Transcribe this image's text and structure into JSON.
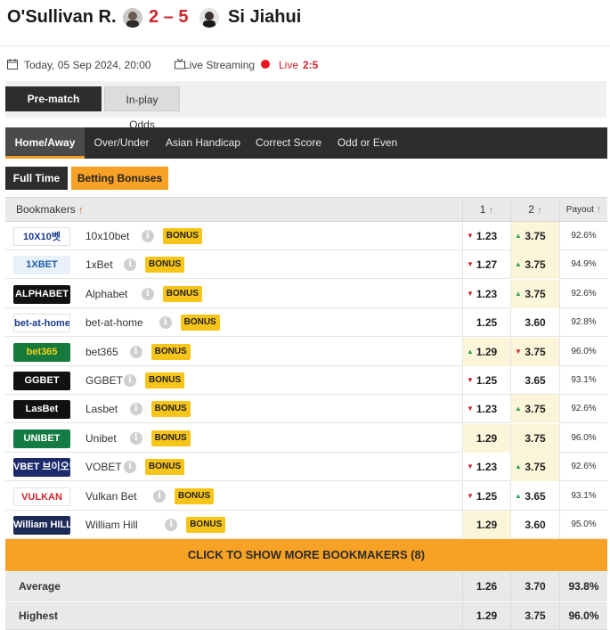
{
  "match": {
    "home_name": "O'Sullivan R.",
    "score": "2 – 5",
    "away_name": "Si Jiahui"
  },
  "info": {
    "date": "Today, 05 Sep 2024, 20:00",
    "streaming": "Live Streaming",
    "live_label": "Live",
    "live_score": "2:5"
  },
  "odds_type_tabs": [
    "Pre-match Odds",
    "In-play Odds"
  ],
  "market_tabs": [
    "Home/Away",
    "Over/Under",
    "Asian Handicap",
    "Correct Score",
    "Odd or Even"
  ],
  "time_tabs": [
    "Full Time",
    "Betting Bonuses"
  ],
  "table": {
    "headers": {
      "bookmakers": "Bookmakers",
      "col1": "1",
      "col2": "2",
      "payout": "Payout"
    },
    "rows": [
      {
        "logo_text": "10X10벳",
        "logo_bg": "#ffffff",
        "logo_fg": "#1a3a8c",
        "name": "10x10bet",
        "bonus": "BONUS",
        "odd1": "1.23",
        "odd1_move": "down",
        "odd2": "3.75",
        "odd2_move": "up",
        "payout": "92.6%",
        "hl1": false,
        "hl2": true
      },
      {
        "logo_text": "1XBET",
        "logo_bg": "#e9f0f8",
        "logo_fg": "#1b5fa8",
        "name": "1xBet",
        "bonus": "BONUS",
        "odd1": "1.27",
        "odd1_move": "down",
        "odd2": "3.75",
        "odd2_move": "up",
        "payout": "94.9%",
        "hl1": false,
        "hl2": true
      },
      {
        "logo_text": "ALPHABET",
        "logo_bg": "#111111",
        "logo_fg": "#ffffff",
        "name": "Alphabet",
        "bonus": "BONUS",
        "odd1": "1.23",
        "odd1_move": "down",
        "odd2": "3.75",
        "odd2_move": "up",
        "payout": "92.6%",
        "hl1": false,
        "hl2": true
      },
      {
        "logo_text": "bet-at-home",
        "logo_bg": "#ffffff",
        "logo_fg": "#1a3c8c",
        "name": "bet-at-home",
        "bonus": "BONUS",
        "odd1": "1.25",
        "odd1_move": "",
        "odd2": "3.60",
        "odd2_move": "",
        "payout": "92.8%",
        "hl1": false,
        "hl2": false
      },
      {
        "logo_text": "bet365",
        "logo_bg": "#157a3c",
        "logo_fg": "#f7d21a",
        "name": "bet365",
        "bonus": "BONUS",
        "odd1": "1.29",
        "odd1_move": "up",
        "odd2": "3.75",
        "odd2_move": "down",
        "payout": "96.0%",
        "hl1": true,
        "hl2": true
      },
      {
        "logo_text": "GGBET",
        "logo_bg": "#111111",
        "logo_fg": "#ffffff",
        "name": "GGBET",
        "bonus": "BONUS",
        "odd1": "1.25",
        "odd1_move": "down",
        "odd2": "3.65",
        "odd2_move": "",
        "payout": "93.1%",
        "hl1": false,
        "hl2": false
      },
      {
        "logo_text": "LasBet",
        "logo_bg": "#111111",
        "logo_fg": "#ffffff",
        "name": "Lasbet",
        "bonus": "BONUS",
        "odd1": "1.23",
        "odd1_move": "down",
        "odd2": "3.75",
        "odd2_move": "up",
        "payout": "92.6%",
        "hl1": false,
        "hl2": true
      },
      {
        "logo_text": "UNIBET",
        "logo_bg": "#147b45",
        "logo_fg": "#ffffff",
        "name": "Unibet",
        "bonus": "BONUS",
        "odd1": "1.29",
        "odd1_move": "",
        "odd2": "3.75",
        "odd2_move": "",
        "payout": "96.0%",
        "hl1": true,
        "hl2": true
      },
      {
        "logo_text": "VBET 브이오벳",
        "logo_bg": "#1b2a6b",
        "logo_fg": "#ffffff",
        "name": "VOBET",
        "bonus": "BONUS",
        "odd1": "1.23",
        "odd1_move": "down",
        "odd2": "3.75",
        "odd2_move": "up",
        "payout": "92.6%",
        "hl1": false,
        "hl2": true
      },
      {
        "logo_text": "VULKAN",
        "logo_bg": "#ffffff",
        "logo_fg": "#d0232a",
        "name": "Vulkan Bet",
        "bonus": "BONUS",
        "odd1": "1.25",
        "odd1_move": "down",
        "odd2": "3.65",
        "odd2_move": "up",
        "payout": "93.1%",
        "hl1": false,
        "hl2": false
      },
      {
        "logo_text": "William HILL",
        "logo_bg": "#1c2a57",
        "logo_fg": "#ffffff",
        "name": "William Hill",
        "bonus": "BONUS",
        "odd1": "1.29",
        "odd1_move": "",
        "odd2": "3.60",
        "odd2_move": "",
        "payout": "95.0%",
        "hl1": true,
        "hl2": false
      }
    ]
  },
  "show_more": "CLICK TO SHOW MORE BOOKMAKERS (8)",
  "summary": [
    {
      "label": "Average",
      "odd1": "1.26",
      "odd2": "3.70",
      "payout": "93.8%"
    },
    {
      "label": "Highest",
      "odd1": "1.29",
      "odd2": "3.75",
      "payout": "96.0%"
    }
  ],
  "colors": {
    "accent": "#f7a225",
    "score": "#d0232a",
    "dark": "#2d2d2d",
    "up": "#2aa35a",
    "down": "#d0232a",
    "bonus": "#f7c51a"
  }
}
